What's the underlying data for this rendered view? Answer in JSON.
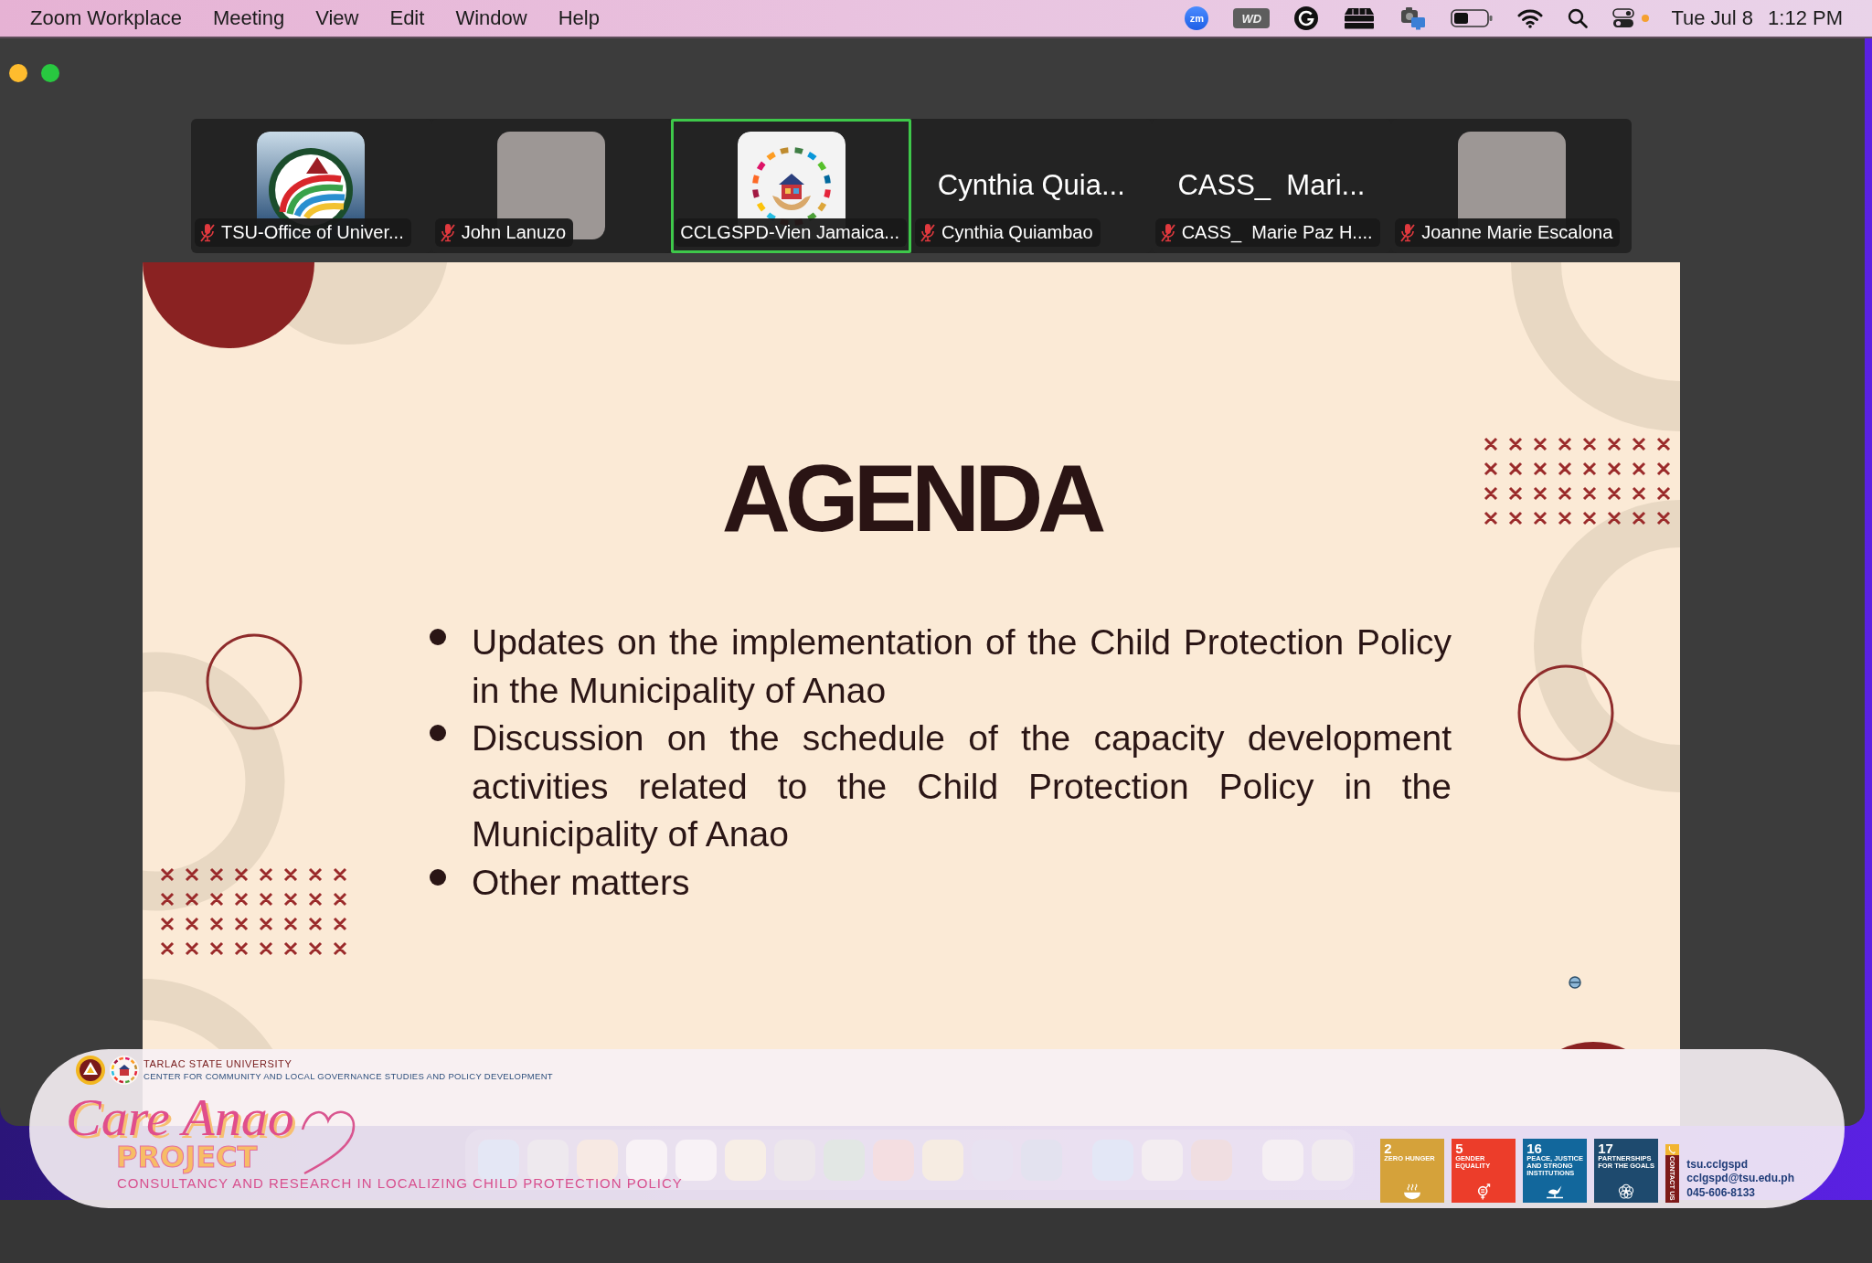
{
  "menu_bar": {
    "app_name": "Zoom Workplace",
    "menus": [
      "Meeting",
      "View",
      "Edit",
      "Window",
      "Help"
    ],
    "status_icons": [
      {
        "kind": "zoom",
        "label": "zm"
      },
      {
        "kind": "wd",
        "label": "WD"
      },
      {
        "kind": "grammarly"
      },
      {
        "kind": "drive"
      },
      {
        "kind": "screen-camera"
      },
      {
        "kind": "battery"
      },
      {
        "kind": "wifi"
      },
      {
        "kind": "search"
      },
      {
        "kind": "control-center"
      },
      {
        "kind": "status-dot"
      }
    ],
    "date": "Tue Jul 8",
    "time": "1:12 PM"
  },
  "participants": [
    {
      "kind": "seal",
      "name": "TSU-Office of Univer...",
      "muted": true,
      "active_speaker": false
    },
    {
      "kind": "photo",
      "name": "John Lanuzo",
      "muted": true,
      "active_speaker": false
    },
    {
      "kind": "emblem",
      "name": "CCLGSPD-Vien Jamaica...",
      "muted": false,
      "active_speaker": true
    },
    {
      "kind": "name",
      "display_name": "Cynthia Quia...",
      "name": "Cynthia Quiambao",
      "muted": true,
      "active_speaker": false
    },
    {
      "kind": "name",
      "display_name": "CASS_  Mari...",
      "name": "CASS_  Marie Paz H....",
      "muted": true,
      "active_speaker": false
    },
    {
      "kind": "photo",
      "name": "Joanne Marie Escalona",
      "muted": true,
      "active_speaker": false
    }
  ],
  "slide": {
    "title": "AGENDA",
    "bullets": [
      "Updates on the implementation of the Child Protection Policy in the Municipality of Anao",
      "Discussion on the schedule of the capacity development activities related to the Child Protection Policy in the Municipality of Anao",
      "Other matters"
    ]
  },
  "banner": {
    "university": "TARLAC STATE UNIVERSITY",
    "center": "CENTER FOR COMMUNITY AND LOCAL GOVERNANCE STUDIES AND POLICY DEVELOPMENT",
    "project_title": "Care Anao",
    "project_word": "PROJECT",
    "tagline": "CONSULTANCY AND RESEARCH IN LOCALIZING CHILD PROTECTION POLICY",
    "sdg_goals": [
      {
        "kind": "hunger",
        "number": "2",
        "label": "ZERO HUNGER",
        "color": "#d5a23a"
      },
      {
        "kind": "equality",
        "number": "5",
        "label": "GENDER EQUALITY",
        "color": "#ec3d2a"
      },
      {
        "kind": "peace",
        "number": "16",
        "label": "PEACE, JUSTICE AND STRONG INSTITUTIONS",
        "color": "#12679c"
      },
      {
        "kind": "partnership",
        "number": "17",
        "label": "PARTNERSHIPS FOR THE GOALS",
        "color": "#1e4a6e"
      }
    ],
    "contact_tab": "CONTACT US",
    "contact": [
      "tsu.cclgspd",
      "cclgspd@tsu.edu.ph",
      "045-606-8133"
    ]
  }
}
